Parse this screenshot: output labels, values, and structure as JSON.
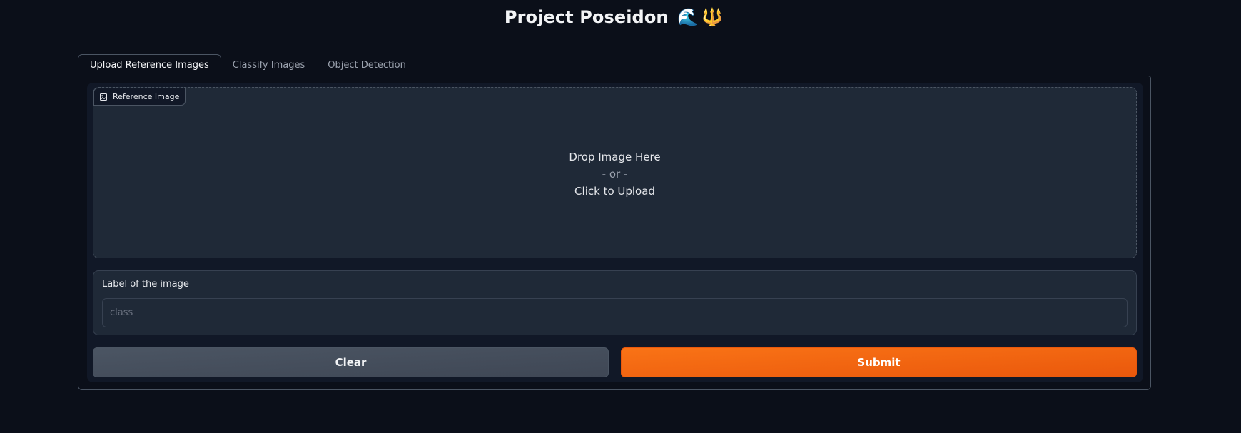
{
  "header": {
    "title": "Project Poseidon",
    "emoji_wave": "🌊",
    "emoji_trident": "🔱"
  },
  "tabs": [
    {
      "label": "Upload Reference Images",
      "active": true
    },
    {
      "label": "Classify Images",
      "active": false
    },
    {
      "label": "Object Detection",
      "active": false
    }
  ],
  "upload": {
    "label": "Reference Image",
    "icon": "image-icon",
    "drop_text": "Drop Image Here",
    "or_text": "- or -",
    "click_text": "Click to Upload"
  },
  "label_field": {
    "label": "Label of the image",
    "placeholder": "class",
    "value": ""
  },
  "buttons": {
    "clear": "Clear",
    "submit": "Submit"
  },
  "colors": {
    "background": "#0b0f19",
    "accent": "#f97316",
    "secondary_button": "#4b5563"
  }
}
